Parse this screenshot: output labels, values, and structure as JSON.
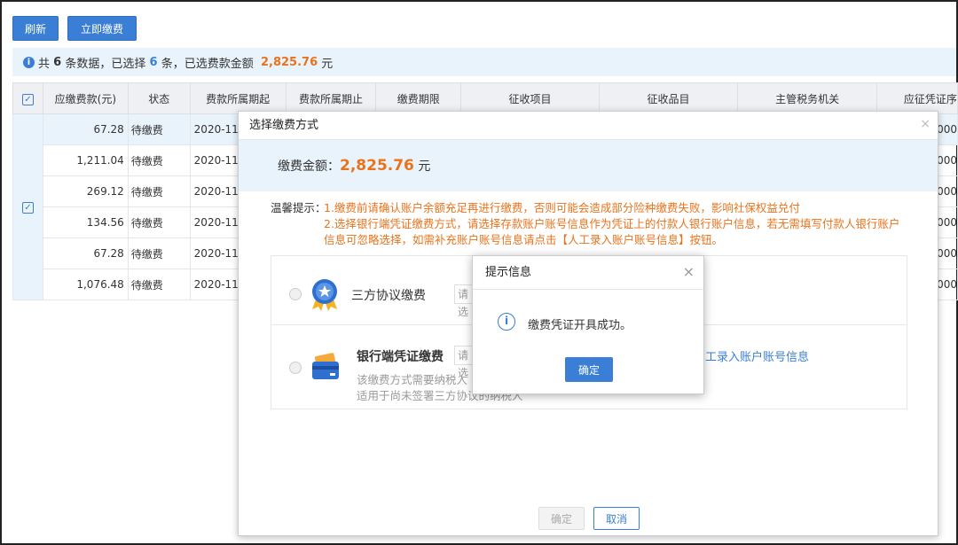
{
  "toolbar": {
    "refresh_label": "刷新",
    "pay_now_label": "立即缴费"
  },
  "info": {
    "prefix": "共",
    "total": "6",
    "mid1": "条数据，已选择",
    "selected": "6",
    "mid2": "条，已选费款金额",
    "amount": "2,825.76",
    "unit": "元"
  },
  "table": {
    "columns": [
      "应缴费款(元)",
      "状态",
      "费款所属期起",
      "费款所属期止",
      "缴费期限",
      "征收项目",
      "征收品目",
      "主管税务机关",
      "应征凭证序"
    ],
    "rows": [
      {
        "amount": "67.28",
        "status": "待缴费",
        "period_start": "2020-11-",
        "tail": "000"
      },
      {
        "amount": "1,211.04",
        "status": "待缴费",
        "period_start": "2020-11-",
        "tail": "000"
      },
      {
        "amount": "269.12",
        "status": "待缴费",
        "period_start": "2020-11-",
        "tail": "000"
      },
      {
        "amount": "134.56",
        "status": "待缴费",
        "period_start": "2020-11-",
        "tail": "000"
      },
      {
        "amount": "67.28",
        "status": "待缴费",
        "period_start": "2020-11-",
        "tail": "000"
      },
      {
        "amount": "1,076.48",
        "status": "待缴费",
        "period_start": "2020-11-",
        "tail": "000"
      }
    ]
  },
  "modal": {
    "title": "选择缴费方式",
    "close": "×",
    "fee_label": "缴费金额：",
    "fee_value": "2,825.76",
    "fee_unit": "元",
    "tips_label": "温馨提示：",
    "tip_line1": "1.缴费前请确认账户余额充足再进行缴费，否则可能会造成部分险种缴费失败，影响社保权益兑付",
    "tip_line2": "2.选择银行端凭证缴费方式，请选择存款账户账号信息作为凭证上的付款人银行账户信息，若无需填写付款人银行账户",
    "tip_line3": "信息可忽略选择，如需补充账户账号信息请点击【人工录入账户账号信息】按钮。",
    "option1_label": "三方协议缴费",
    "option1_select": "请选",
    "option2_label": "银行端凭证缴费",
    "option2_select": "请选",
    "option2_desc1": "该缴费方式需要纳税人",
    "option2_desc2": "适用于尚未签署三方协议的纳税人",
    "manual_link": "工录入账户账号信息",
    "confirm_label": "确定",
    "cancel_label": "取消"
  },
  "dialog": {
    "title": "提示信息",
    "close": "×",
    "message": "缴费凭证开具成功。",
    "ok_label": "确定"
  },
  "colors": {
    "primary": "#3a7fd5",
    "accent": "#e8731c",
    "light_bg": "#e9f3fb"
  }
}
